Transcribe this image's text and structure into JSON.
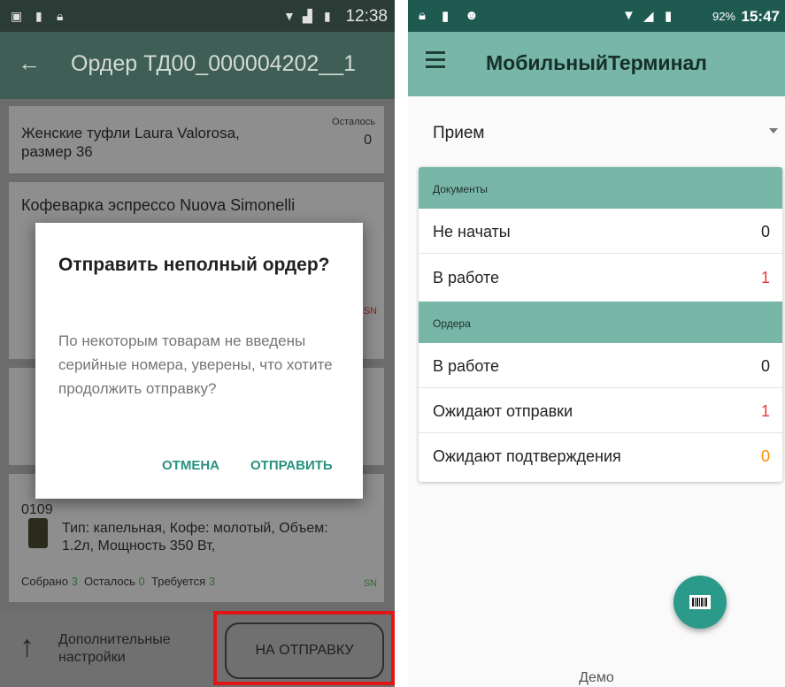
{
  "left": {
    "status_time": "12:38",
    "appbar_title": "Ордер ТД00_000004202__1",
    "item1": {
      "name": "Женские туфли Laura Valorosa, размер 36",
      "remaining_label": "Осталось",
      "remaining_value": "0"
    },
    "item2": {
      "name": "Кофеварка эспрессо Nuova Simonelli"
    },
    "item3": {
      "name_tail": "0109",
      "specs": "Тип: капельная, Кофе: молотый, Объем: 1.2л, Мощность 350 Вт,",
      "collected_label": "Собрано",
      "collected_value": "3",
      "remaining_label": "Осталось",
      "remaining_value": "0",
      "required_label": "Требуется",
      "required_value": "3",
      "sn": "SN"
    },
    "side_sn": "SN",
    "bottom": {
      "extra_settings": "Дополнительные настройки",
      "send_button": "НА ОТПРАВКУ"
    },
    "dialog": {
      "title": "Отправить неполный ордер?",
      "message": "По некоторым товарам не введены серийные номера, уверены, что хотите продолжить отправку?",
      "cancel": "ОТМЕНА",
      "confirm": "ОТПРАВИТЬ"
    }
  },
  "right": {
    "status_battery": "92%",
    "status_time": "15:47",
    "appbar_title": "МобильныйТерминал",
    "select_value": "Прием",
    "documents_header": "Документы",
    "documents": [
      {
        "label": "Не начаты",
        "value": "0",
        "color": "#222222"
      },
      {
        "label": "В работе",
        "value": "1",
        "color": "#e53935"
      }
    ],
    "orders_header": "Ордера",
    "orders": [
      {
        "label": "В работе",
        "value": "0",
        "color": "#222222"
      },
      {
        "label": "Ожидают отправки",
        "value": "1",
        "color": "#e53935"
      },
      {
        "label": "Ожидают подтверждения",
        "value": "0",
        "color": "#fb8c00"
      }
    ],
    "footer": "Демо"
  },
  "colors": {
    "accent": "#78b6a8",
    "fab": "#2b9a8a",
    "dialog_button": "#26927f",
    "highlight": "#e01616"
  }
}
